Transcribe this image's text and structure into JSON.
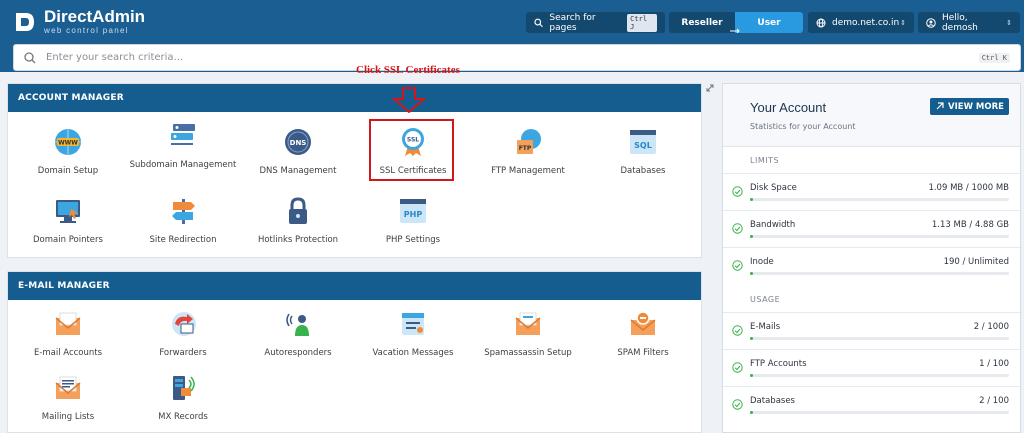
{
  "app": {
    "name": "DirectAdmin",
    "tagline": "web control panel"
  },
  "topbar": {
    "search_label": "Search for pages",
    "search_shortcut": "Ctrl J",
    "role_reseller": "Reseller",
    "role_user": "User",
    "domain": "demo.net.co.in",
    "greeting": "Hello, demosh"
  },
  "search": {
    "placeholder": "Enter your search criteria...",
    "shortcut": "Ctrl K"
  },
  "annotation": {
    "text": "Click SSL Certificates"
  },
  "account_manager": {
    "title": "ACCOUNT MANAGER",
    "items": [
      {
        "label": "Domain Setup",
        "icon": "www-globe-icon"
      },
      {
        "label": "Subdomain Management",
        "icon": "subdomain-icon"
      },
      {
        "label": "DNS Management",
        "icon": "dns-icon"
      },
      {
        "label": "SSL Certificates",
        "icon": "ssl-badge-icon"
      },
      {
        "label": "FTP Management",
        "icon": "ftp-icon"
      },
      {
        "label": "Databases",
        "icon": "sql-database-icon"
      },
      {
        "label": "Domain Pointers",
        "icon": "domain-pointer-icon"
      },
      {
        "label": "Site Redirection",
        "icon": "signpost-icon"
      },
      {
        "label": "Hotlinks Protection",
        "icon": "lock-icon"
      },
      {
        "label": "PHP Settings",
        "icon": "php-icon"
      }
    ]
  },
  "email_manager": {
    "title": "E-MAIL MANAGER",
    "items": [
      {
        "label": "E-mail Accounts",
        "icon": "envelope-icon"
      },
      {
        "label": "Forwarders",
        "icon": "forwarder-icon"
      },
      {
        "label": "Autoresponders",
        "icon": "autoresponder-icon"
      },
      {
        "label": "Vacation Messages",
        "icon": "vacation-icon"
      },
      {
        "label": "Spamassassin Setup",
        "icon": "spam-envelope-icon"
      },
      {
        "label": "SPAM Filters",
        "icon": "spam-filter-icon"
      },
      {
        "label": "Mailing Lists",
        "icon": "mailing-list-icon"
      },
      {
        "label": "MX Records",
        "icon": "mx-records-icon"
      }
    ]
  },
  "your_account": {
    "title": "Your Account",
    "subtitle": "Statistics for your Account",
    "view_more": "VIEW MORE",
    "limits_label": "LIMITS",
    "usage_label": "USAGE",
    "limits": [
      {
        "name": "Disk Space",
        "value": "1.09 MB / 1000 MB",
        "fraction": 0.01
      },
      {
        "name": "Bandwidth",
        "value": "1.13 MB / 4.88 GB",
        "fraction": 0.01
      },
      {
        "name": "Inode",
        "value": "190 / Unlimited",
        "fraction": 0.01
      }
    ],
    "usage": [
      {
        "name": "E-Mails",
        "value": "2 / 1000",
        "fraction": 0.01
      },
      {
        "name": "FTP Accounts",
        "value": "1 / 100",
        "fraction": 0.01
      },
      {
        "name": "Databases",
        "value": "2 / 100",
        "fraction": 0.01
      }
    ]
  },
  "colors": {
    "topbar": "#1b5f92",
    "panel_header": "#145d8e",
    "accent": "#2a9ae0",
    "annotation": "#d0181c",
    "progress": "#37b24d"
  }
}
